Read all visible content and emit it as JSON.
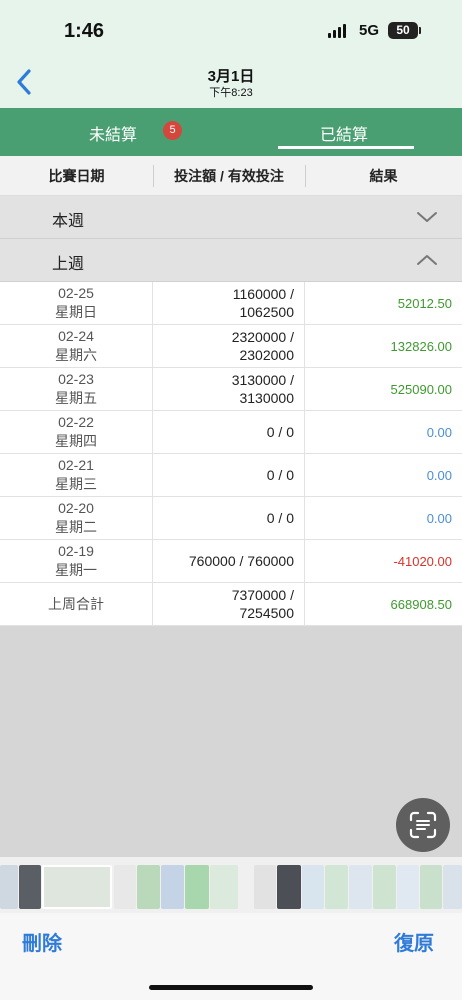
{
  "status_bar": {
    "time": "1:46",
    "network": "5G",
    "battery": "50"
  },
  "nav": {
    "date": "3月1日",
    "time": "下午8:23"
  },
  "tabs": {
    "unsettled_label": "未結算",
    "unsettled_badge": "5",
    "settled_label": "已結算"
  },
  "table_header": {
    "date": "比賽日期",
    "bet": "投注額 / 有效投注",
    "result": "結果"
  },
  "sections": {
    "this_week": "本週",
    "last_week": "上週"
  },
  "rows": [
    {
      "date": "02-25",
      "weekday": "星期日",
      "bet_line1": "1160000 /",
      "bet_line2": "1062500",
      "result": "52012.50"
    },
    {
      "date": "02-24",
      "weekday": "星期六",
      "bet_line1": "2320000 /",
      "bet_line2": "2302000",
      "result": "132826.00"
    },
    {
      "date": "02-23",
      "weekday": "星期五",
      "bet_line1": "3130000 /",
      "bet_line2": "3130000",
      "result": "525090.00"
    },
    {
      "date": "02-22",
      "weekday": "星期四",
      "bet_line1": "0 / 0",
      "bet_line2": "",
      "result": "0.00"
    },
    {
      "date": "02-21",
      "weekday": "星期三",
      "bet_line1": "0 / 0",
      "bet_line2": "",
      "result": "0.00"
    },
    {
      "date": "02-20",
      "weekday": "星期二",
      "bet_line1": "0 / 0",
      "bet_line2": "",
      "result": "0.00"
    },
    {
      "date": "02-19",
      "weekday": "星期一",
      "bet_line1": "760000 / 760000",
      "bet_line2": "",
      "result": "-41020.00"
    }
  ],
  "total": {
    "label": "上周合計",
    "bet_line1": "7370000 /",
    "bet_line2": "7254500",
    "result": "668908.50"
  },
  "bottom": {
    "delete": "刪除",
    "restore": "復原"
  },
  "colors": {
    "accent_green": "#4a9f72",
    "positive": "#3e9a2f",
    "zero": "#4a8fd6",
    "negative": "#d9332b",
    "link_blue": "#2f7bd8"
  },
  "icons": {
    "back": "chevron-left-icon",
    "collapse": "chevron-up-icon",
    "expand": "chevron-down-icon",
    "scan": "live-text-scan-icon"
  }
}
